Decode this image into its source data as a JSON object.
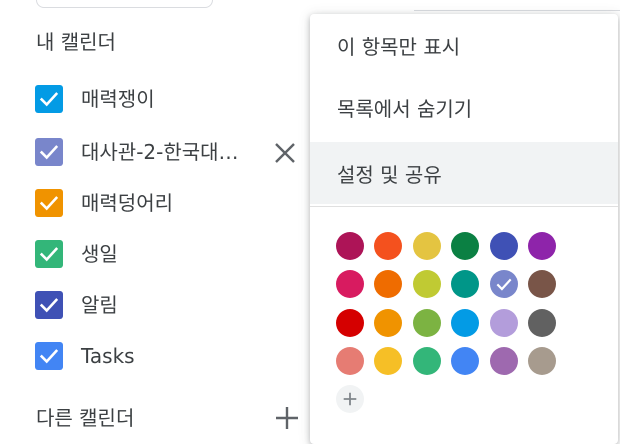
{
  "sidebar": {
    "my_calendars_title": "내 캘린더",
    "other_calendars_title": "다른 캘린더",
    "calendars": [
      {
        "label": "매력쟁이",
        "color": "#039be5"
      },
      {
        "label": "대사관-2-한국대…",
        "color": "#7986cb"
      },
      {
        "label": "매력덩어리",
        "color": "#f09300"
      },
      {
        "label": "생일",
        "color": "#33b679"
      },
      {
        "label": "알림",
        "color": "#3f51b5"
      },
      {
        "label": "Tasks",
        "color": "#4285f4"
      }
    ],
    "close_icon": "close-icon",
    "add_icon": "plus-icon"
  },
  "menu": {
    "items": [
      {
        "label": "이 항목만 표시"
      },
      {
        "label": "목록에서 숨기기"
      },
      {
        "label": "설정 및 공유"
      }
    ],
    "colors": [
      "#ad1457",
      "#f4511e",
      "#e4c441",
      "#0b8043",
      "#3f51b5",
      "#8e24aa",
      "#d81b60",
      "#ef6c00",
      "#c0ca33",
      "#009688",
      "#7986cb",
      "#795548",
      "#d50000",
      "#f09300",
      "#7cb342",
      "#039be5",
      "#b39ddb",
      "#616161",
      "#e67c73",
      "#f6bf26",
      "#33b679",
      "#4285f4",
      "#9e69af",
      "#a79b8e"
    ],
    "selected_color": "#7986cb",
    "add_color_icon": "plus-icon"
  }
}
